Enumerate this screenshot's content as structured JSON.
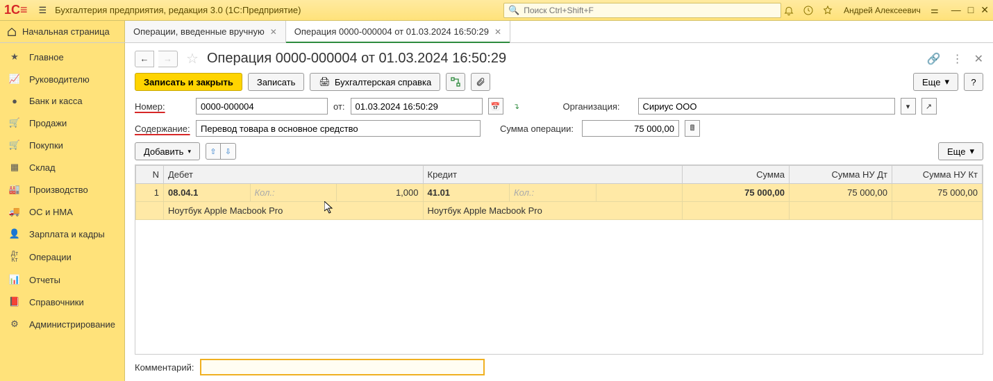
{
  "app": {
    "title": "Бухгалтерия предприятия, редакция 3.0  (1С:Предприятие)",
    "search_placeholder": "Поиск Ctrl+Shift+F",
    "user": "Андрей Алексеевич"
  },
  "tabs": {
    "home": "Начальная страница",
    "t1": "Операции, введенные вручную",
    "t2": "Операция 0000-000004 от 01.03.2024 16:50:29"
  },
  "sidebar": {
    "items": [
      "Главное",
      "Руководителю",
      "Банк и касса",
      "Продажи",
      "Покупки",
      "Склад",
      "Производство",
      "ОС и НМА",
      "Зарплата и кадры",
      "Операции",
      "Отчеты",
      "Справочники",
      "Администрирование"
    ]
  },
  "doc": {
    "title": "Операция 0000-000004 от 01.03.2024 16:50:29",
    "btn_save_close": "Записать и закрыть",
    "btn_save": "Записать",
    "btn_report": "Бухгалтерская справка",
    "btn_more": "Еще",
    "label_number": "Номер:",
    "number": "0000-000004",
    "label_from": "от:",
    "date": "01.03.2024 16:50:29",
    "label_org": "Организация:",
    "org": "Сириус ООО",
    "label_content": "Содержание:",
    "content_val": "Перевод товара в основное средство",
    "label_sum": "Сумма операции:",
    "sum": "75 000,00",
    "btn_add": "Добавить",
    "btn_more2": "Еще",
    "label_comment": "Комментарий:",
    "comment": ""
  },
  "table": {
    "headers": {
      "n": "N",
      "debit": "Дебет",
      "credit": "Кредит",
      "sum": "Сумма",
      "nu_dt": "Сумма НУ Дт",
      "nu_kt": "Сумма НУ Кт"
    },
    "qty_label": "Кол.:",
    "rows": [
      {
        "n": "1",
        "debit_acc": "08.04.1",
        "debit_qty": "1,000",
        "debit_name": "Ноутбук Apple Macbook Pro",
        "credit_acc": "41.01",
        "credit_qty": "",
        "credit_name": "Ноутбук Apple Macbook Pro",
        "sum": "75 000,00",
        "nu_dt": "75 000,00",
        "nu_kt": "75 000,00"
      }
    ]
  }
}
